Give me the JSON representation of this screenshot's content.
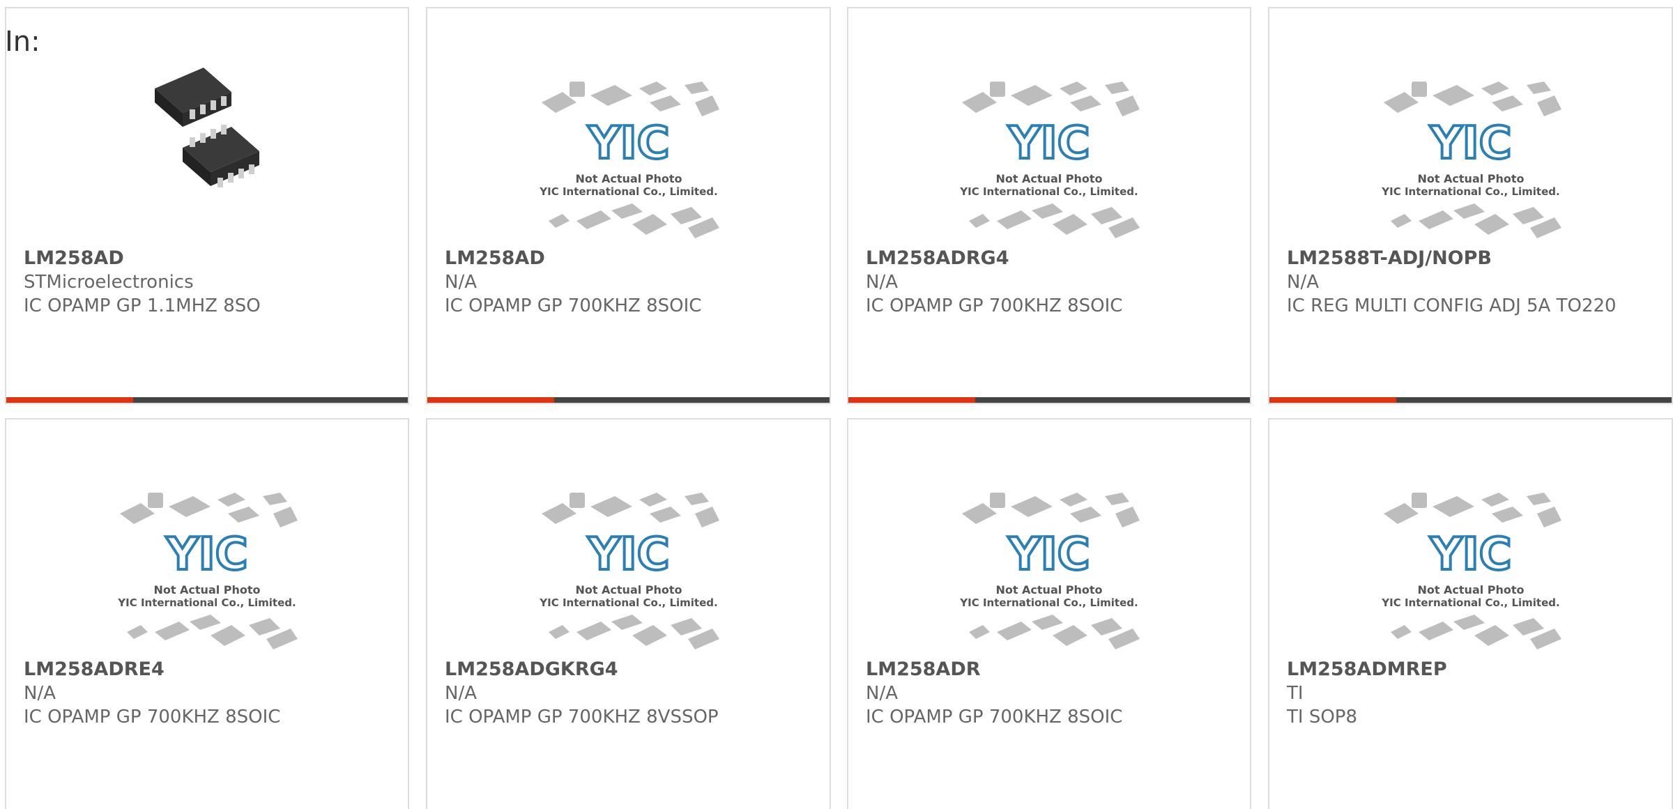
{
  "header": {
    "in_label": "In:"
  },
  "brand": {
    "accent": "#dd3311",
    "bar": "#444444",
    "logo": "#2a7fb5"
  },
  "placeholder": {
    "logo_text": "YIC",
    "line1": "Not Actual Photo",
    "line2": "YIC International Co., Limited."
  },
  "products": [
    {
      "part": "LM258AD",
      "manufacturer": "STMicroelectronics",
      "description": "IC OPAMP GP 1.1MHZ 8SO",
      "image": "soic-8-chip-photo"
    },
    {
      "part": "LM258AD",
      "manufacturer": "N/A",
      "description": "IC OPAMP GP 700KHZ 8SOIC",
      "image": "yic-placeholder"
    },
    {
      "part": "LM258ADRG4",
      "manufacturer": "N/A",
      "description": "IC OPAMP GP 700KHZ 8SOIC",
      "image": "yic-placeholder"
    },
    {
      "part": "LM2588T-ADJ/NOPB",
      "manufacturer": "N/A",
      "description": "IC REG MULTI CONFIG ADJ 5A TO220",
      "image": "yic-placeholder"
    },
    {
      "part": "LM258ADRE4",
      "manufacturer": "N/A",
      "description": "IC OPAMP GP 700KHZ 8SOIC",
      "image": "yic-placeholder"
    },
    {
      "part": "LM258ADGKRG4",
      "manufacturer": "N/A",
      "description": "IC OPAMP GP 700KHZ 8VSSOP",
      "image": "yic-placeholder"
    },
    {
      "part": "LM258ADR",
      "manufacturer": "N/A",
      "description": "IC OPAMP GP 700KHZ 8SOIC",
      "image": "yic-placeholder"
    },
    {
      "part": "LM258ADMREP",
      "manufacturer": "TI",
      "description": "TI SOP8",
      "image": "yic-placeholder"
    }
  ]
}
